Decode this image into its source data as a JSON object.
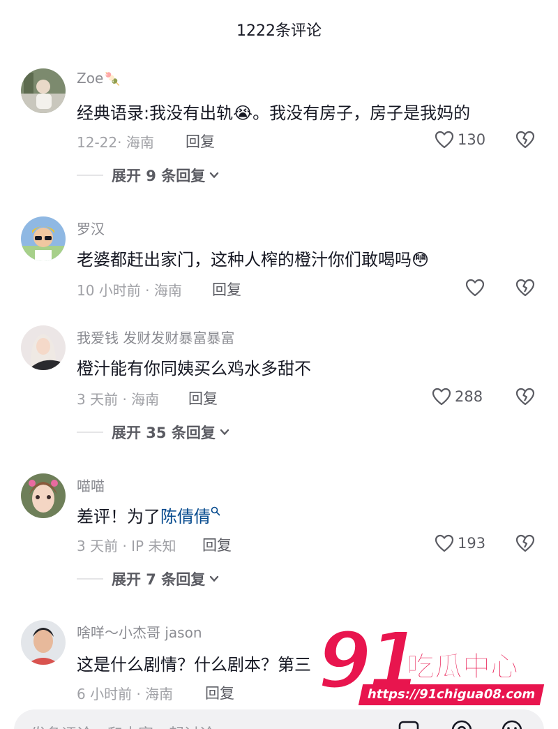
{
  "header": {
    "title": "1222条评论"
  },
  "comments": [
    {
      "username": "Zoe",
      "username_emoji": "🍡",
      "text": "经典语录:我没有出轨😭。我没有房子，房子是我妈的",
      "meta": "12-22· 海南",
      "reply_label": "回复",
      "likes": "130",
      "expand": "展开 9 条回复"
    },
    {
      "username": "罗汉",
      "text": "老婆都赶出家门，这种人榨的橙汁你们敢喝吗😳",
      "meta": "10 小时前 · 海南",
      "reply_label": "回复"
    },
    {
      "username": "我爱钱  发财发财暴富暴富",
      "text": "橙汁能有你同姨买么鸡水多甜不",
      "meta": "3 天前 · 海南",
      "reply_label": "回复",
      "likes": "288",
      "expand": "展开 35 条回复"
    },
    {
      "username": "喵喵",
      "text_prefix": "差评！为了",
      "text_link": "陈倩倩",
      "meta": "3 天前 · IP 未知",
      "reply_label": "回复",
      "likes": "193",
      "expand": "展开 7 条回复"
    },
    {
      "username": "啥咩～小杰哥 jason",
      "text": "这是什么剧情？什么剧本？第三",
      "meta": "6 小时前 · 海南",
      "reply_label": "回复"
    }
  ],
  "bottom_bar": {
    "placeholder": "发条评论，和大家一起讨论"
  },
  "watermark": {
    "number": "91",
    "title": "吃瓜中心",
    "url": "https://91chigua08.com"
  },
  "colors": {
    "link": "#04498d",
    "brand": "#e8154e",
    "meta": "#a0a1a6"
  },
  "icons": [
    "heart-icon",
    "dislike-heart-icon",
    "chevron-down-icon",
    "image-icon",
    "at-icon",
    "emoji-icon",
    "search-icon"
  ]
}
